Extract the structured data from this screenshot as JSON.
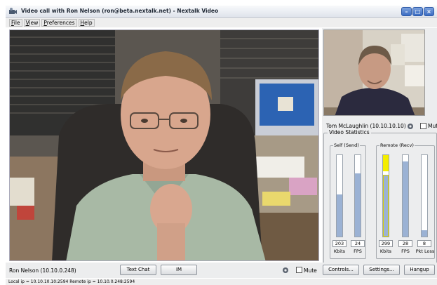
{
  "window": {
    "title": "Video call with Ron Nelson (ron@beta.nextalk.net) - Nextalk Video",
    "controls": [
      "–",
      "□",
      "×"
    ]
  },
  "menu": [
    {
      "label": "File"
    },
    {
      "label": "View"
    },
    {
      "label": "Preferences"
    },
    {
      "label": "Help"
    }
  ],
  "self_view": {
    "name": "Tom McLaughlin (10.10.10.10)",
    "mute_label": "Mute"
  },
  "stats": {
    "title": "Video Statistics",
    "self_group": "Self (Send)",
    "remote_group": "Remote (Recv)",
    "bars": [
      {
        "label": "Kbits",
        "value": "203",
        "level": 0.52
      },
      {
        "label": "FPS",
        "value": "24",
        "level": 0.78
      },
      {
        "label": "Kbits",
        "value": "299",
        "level": 0.76,
        "peak": 0.2
      },
      {
        "label": "FPS",
        "value": "28",
        "level": 0.92
      },
      {
        "label": "Pkt Loss",
        "value": "8",
        "level": 0.08
      }
    ]
  },
  "bottom": {
    "remote_name": "Ron Nelson (10.10.0.248)",
    "text_chat": "Text Chat",
    "im": "IM",
    "mute_label": "Mute",
    "controls": "Controls...",
    "settings": "Settings...",
    "hangup": "Hangup"
  },
  "status": "Local ip = 10.10.10.10:2594  Remote ip = 10.10.0.248:2594"
}
